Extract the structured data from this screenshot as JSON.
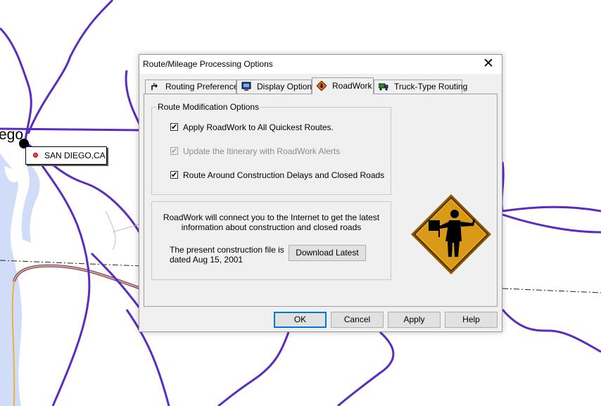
{
  "map": {
    "city_name": "ego",
    "location_label": "SAN DIEGO,CA",
    "colors": {
      "road": "#5b2cc0",
      "highway": "#e8b33a",
      "water": "#d0dcf8"
    }
  },
  "dialog": {
    "title": "Route/Mileage Processing Options",
    "close_glyph": "✕",
    "tabs": [
      {
        "label": "Routing Preferences",
        "icon": "routing-arrow-icon"
      },
      {
        "label": "Display Options",
        "icon": "monitor-icon"
      },
      {
        "label": "RoadWork",
        "icon": "roadwork-sign-icon",
        "active": true
      },
      {
        "label": "Truck-Type Routing",
        "icon": "truck-icon"
      }
    ],
    "route_options": {
      "legend": "Route Modification Options",
      "options": [
        {
          "label": "Apply RoadWork to All Quickest Routes.",
          "checked": true,
          "enabled": true
        },
        {
          "label": "Update the Itinerary with RoadWork Alerts",
          "checked": true,
          "enabled": false
        },
        {
          "label": "Route Around Construction Delays and Closed Roads",
          "checked": true,
          "enabled": true
        }
      ]
    },
    "info": {
      "line1": "RoadWork will connect you to the Internet to get the latest",
      "line2": "information about construction and closed roads",
      "file_line1": "The present construction file is",
      "file_line2": "dated Aug 15, 2001",
      "download_label": "Download Latest"
    },
    "buttons": {
      "ok": "OK",
      "cancel": "Cancel",
      "apply": "Apply",
      "help": "Help"
    },
    "sign_icon": "flagman-construction-sign-icon"
  }
}
